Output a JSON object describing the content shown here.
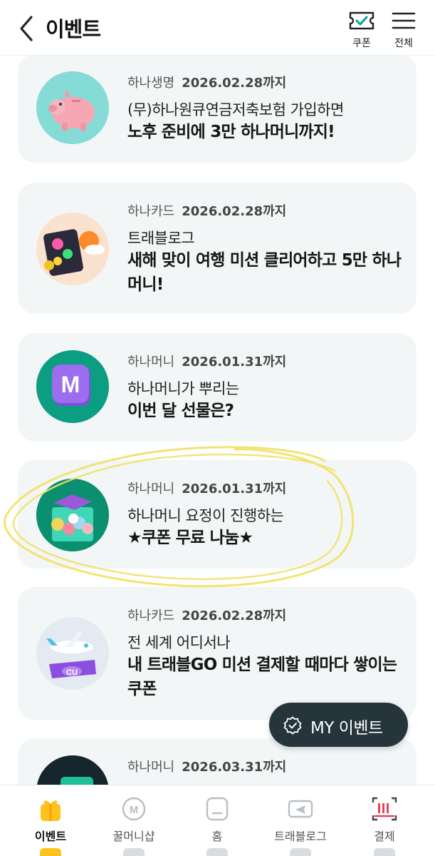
{
  "header": {
    "title": "이벤트",
    "coupon_label": "쿠폰",
    "menu_label": "전체"
  },
  "events": [
    {
      "category": "하나생명",
      "date": "2026.02.28까지",
      "subtitle": "(무)하나원큐연금저축보험 가입하면",
      "headline": "노후 준비에 3만 하나머니까지!",
      "thumb": "piggy-bank-icon"
    },
    {
      "category": "하나카드",
      "date": "2026.02.28까지",
      "subtitle": "트래블로그",
      "headline": "새해 맞이 여행 미션 클리어하고 5만 하나머니!",
      "thumb": "travel-card-icon"
    },
    {
      "category": "하나머니",
      "date": "2026.01.31까지",
      "subtitle": "하나머니가 뿌리는",
      "headline": "이번 달 선물은?",
      "thumb": "m-logo-icon"
    },
    {
      "category": "하나머니",
      "date": "2026.01.31까지",
      "subtitle": "하나머니 요정이 진행하는",
      "headline": "★쿠폰 무료 나눔★",
      "thumb": "gift-box-icon"
    },
    {
      "category": "하나카드",
      "date": "2026.02.28까지",
      "subtitle": "전 세계 어디서나",
      "headline": "내 트래블GO 미션 결제할 때마다 쌓이는 쿠폰",
      "thumb": "airplane-icon"
    },
    {
      "category": "하나머니",
      "date": "2026.03.31까지",
      "subtitle": "",
      "headline": "",
      "thumb": "ticket-icon"
    }
  ],
  "my_event": {
    "label": "MY 이벤트"
  },
  "bottom_nav": [
    {
      "label": "이벤트",
      "icon": "gift-icon",
      "active": true
    },
    {
      "label": "꿀머니샵",
      "icon": "m-coin-icon",
      "active": false
    },
    {
      "label": "홈",
      "icon": "home-icon",
      "active": false
    },
    {
      "label": "트래블로그",
      "icon": "plane-ticket-icon",
      "active": false
    },
    {
      "label": "결제",
      "icon": "barcode-scan-icon",
      "active": false
    }
  ],
  "colors": {
    "accent": "#00a49a",
    "highlight": "#f2e16a",
    "dark_button": "#26343b",
    "card_bg": "#f3f6f6"
  }
}
